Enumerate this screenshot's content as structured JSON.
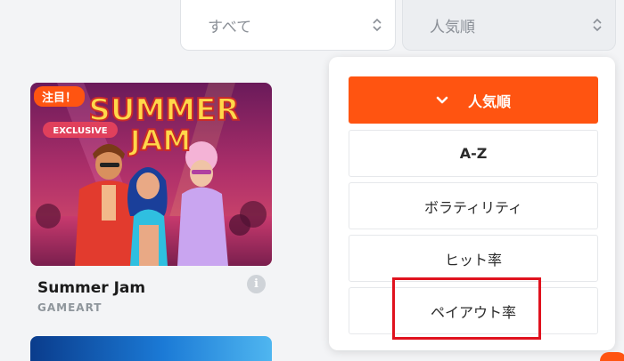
{
  "filters": {
    "category_value": "すべて",
    "sort_value": "人気順"
  },
  "game": {
    "badge": "注目！",
    "title": "Summer Jam",
    "provider": "GAMEART",
    "art_title_line1": "SUMMER",
    "art_title_line2": "JAM",
    "art_tag": "EXCLUSIVE",
    "info_icon_glyph": "i"
  },
  "sort_menu": {
    "options": [
      {
        "label": "人気順",
        "selected": true
      },
      {
        "label": "A-Z",
        "selected": false
      },
      {
        "label": "ボラティリティ",
        "selected": false
      },
      {
        "label": "ヒット率",
        "selected": false
      },
      {
        "label": "ペイアウト率",
        "selected": false
      }
    ]
  },
  "colors": {
    "accent": "#ff5411",
    "highlight_box": "#e0121e",
    "background": "#f3f4f6"
  }
}
